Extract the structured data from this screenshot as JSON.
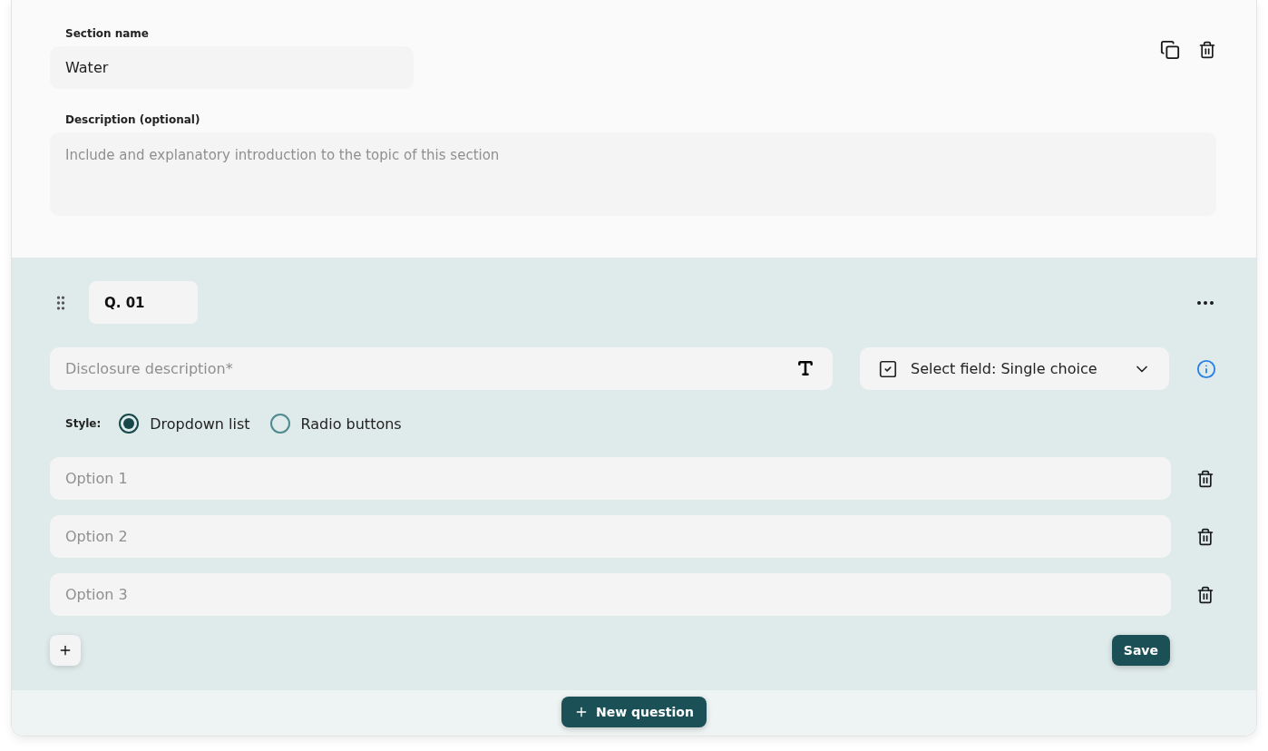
{
  "section": {
    "name_label": "Section name",
    "name_value": "Water",
    "description_label": "Description (optional)",
    "description_placeholder": "Include and explanatory introduction to the topic of this section"
  },
  "question": {
    "number": "Q. 01",
    "description_placeholder": "Disclosure description*",
    "field_type": "Select field: Single choice",
    "style_label": "Style:",
    "styles": [
      {
        "label": "Dropdown list",
        "selected": true
      },
      {
        "label": "Radio buttons",
        "selected": false
      }
    ],
    "options": [
      {
        "placeholder": "Option 1"
      },
      {
        "placeholder": "Option 2"
      },
      {
        "placeholder": "Option 3"
      }
    ],
    "save": "Save"
  },
  "new_question": "New question"
}
